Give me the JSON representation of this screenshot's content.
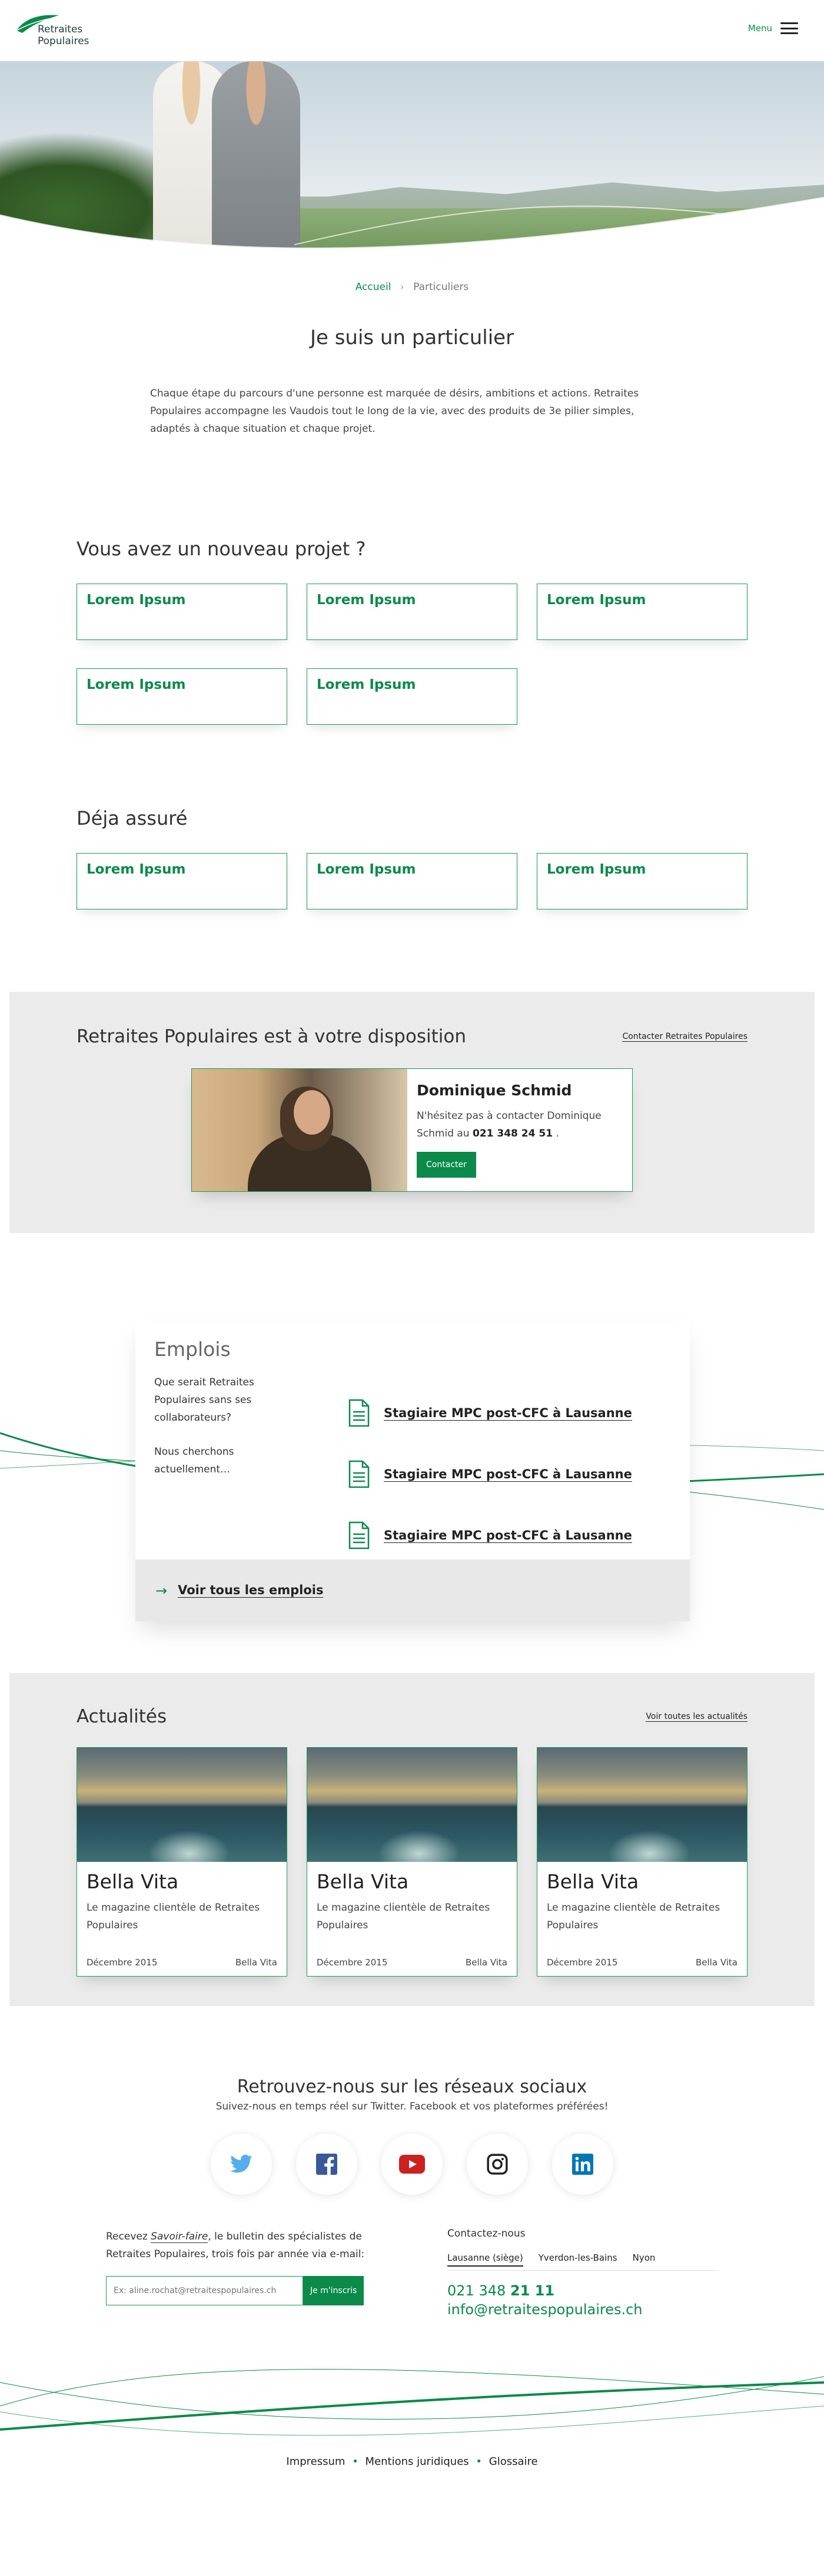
{
  "header": {
    "logo_line1": "Retraites",
    "logo_line2": "Populaires",
    "menu_label": "Menu"
  },
  "breadcrumb": {
    "home": "Accueil",
    "separator": "›",
    "current": "Particuliers"
  },
  "page_title": "Je suis un particulier",
  "intro": "Chaque étape du parcours d'une personne est marquée de désirs, ambitions et actions. Retraites Populaires accompagne les Vaudois tout le long de la vie, avec des produits de 3e pilier simples, adaptés à chaque situation et chaque projet.",
  "nouveau_projet": {
    "title": "Vous avez un nouveau projet ?",
    "cards": [
      "Lorem Ipsum",
      "Lorem Ipsum",
      "Lorem Ipsum",
      "Lorem Ipsum",
      "Lorem Ipsum"
    ]
  },
  "deja_assure": {
    "title": "Déja assuré",
    "cards": [
      "Lorem Ipsum",
      "Lorem Ipsum",
      "Lorem Ipsum"
    ]
  },
  "disposition": {
    "title": "Retraites Populaires est à votre disposition",
    "link": "Contacter Retraites Populaires",
    "contact_name": "Dominique Schmid",
    "contact_text": "N'hésitez pas à contacter Dominique Schmid au",
    "contact_phone": "021 348 24 51",
    "contact_after": ".",
    "contact_button": "Contacter"
  },
  "emplois": {
    "title": "Emplois",
    "desc1": "Que serait Retraites Populaires sans ses collaborateurs?",
    "desc2": "Nous cherchons actuellement…",
    "jobs": [
      "Stagiaire MPC post-CFC à Lausanne",
      "Stagiaire MPC post-CFC à Lausanne",
      "Stagiaire MPC post-CFC à Lausanne"
    ],
    "all_link": "Voir tous les emplois"
  },
  "actualites": {
    "title": "Actualités",
    "link": "Voir toutes les actualités",
    "items": [
      {
        "title": "Bella Vita",
        "desc": "Le magazine clientèle de Retraites Populaires",
        "date": "Décembre 2015",
        "tag": "Bella Vita"
      },
      {
        "title": "Bella Vita",
        "desc": "Le magazine clientèle de Retraites Populaires",
        "date": "Décembre 2015",
        "tag": "Bella Vita"
      },
      {
        "title": "Bella Vita",
        "desc": "Le magazine clientèle de Retraites Populaires",
        "date": "Décembre 2015",
        "tag": "Bella Vita"
      }
    ]
  },
  "social": {
    "title": "Retrouvez-nous sur les réseaux sociaux",
    "subtitle": "Suivez-nous en temps réel sur Twitter. Facebook et vos plateformes préférées!",
    "icons": [
      "twitter-icon",
      "facebook-icon",
      "youtube-icon",
      "instagram-icon",
      "linkedin-icon"
    ]
  },
  "newsletter": {
    "text_before": "Recevez",
    "magazine": "Savoir-faire",
    "text_after": ", le bulletin des spécialistes de Retraites Populaires, trois fois par année via e-mail:",
    "placeholder": "Ex: aline.rochat@retraitespopulaires.ch",
    "button": "Je m'inscris"
  },
  "contact": {
    "title": "Contactez-nous",
    "offices": [
      "Lausanne (siège)",
      "Yverdon-les-Bains",
      "Nyon"
    ],
    "phone_prefix": "021 348",
    "phone_suffix": "21 11",
    "email": "info@retraitespopulaires.ch"
  },
  "footer": {
    "links": [
      "Impressum",
      "Mentions juridiques",
      "Glossaire"
    ],
    "separator": "•"
  },
  "colors": {
    "brand_green": "#0b8a4a",
    "card_border": "#1a9a5a",
    "section_grey": "#ebebeb"
  }
}
